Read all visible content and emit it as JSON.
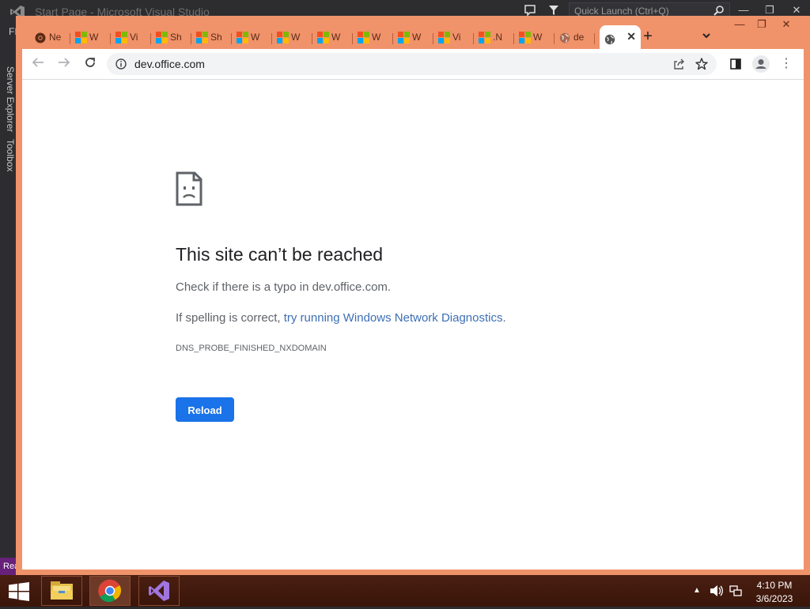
{
  "vs": {
    "title": "Start Page - Microsoft Visual Studio",
    "menu_partial": "FI",
    "quick_launch_placeholder": "Quick Launch (Ctrl+Q)",
    "side_tabs": [
      "Server Explorer",
      "Toolbox"
    ],
    "status_partial": "Rea"
  },
  "browser": {
    "tabs": [
      {
        "label": "Ne",
        "icon": "chrome-icon"
      },
      {
        "label": "W",
        "icon": "microsoft-icon"
      },
      {
        "label": "Vi",
        "icon": "microsoft-icon"
      },
      {
        "label": "Sh",
        "icon": "microsoft-icon"
      },
      {
        "label": "Sh",
        "icon": "microsoft-icon"
      },
      {
        "label": "W",
        "icon": "microsoft-icon"
      },
      {
        "label": "W",
        "icon": "microsoft-icon"
      },
      {
        "label": "W",
        "icon": "microsoft-icon"
      },
      {
        "label": "W",
        "icon": "microsoft-icon"
      },
      {
        "label": "W",
        "icon": "microsoft-icon"
      },
      {
        "label": "Vi",
        "icon": "microsoft-icon"
      },
      {
        "label": ".N",
        "icon": "microsoft-icon"
      },
      {
        "label": "W",
        "icon": "microsoft-icon"
      },
      {
        "label": "de",
        "icon": "globe-icon"
      },
      {
        "label": "",
        "icon": "globe-icon",
        "active": true
      }
    ],
    "url": "dev.office.com"
  },
  "error_page": {
    "title": "This site can’t be reached",
    "line1": "Check if there is a typo in dev.office.com.",
    "line2_prefix": "If spelling is correct, ",
    "line2_link": "try running Windows Network Diagnostics",
    "line2_suffix": ".",
    "code": "DNS_PROBE_FINISHED_NXDOMAIN",
    "reload_label": "Reload"
  },
  "taskbar": {
    "apps": [
      "file-explorer",
      "chrome",
      "visual-studio"
    ],
    "time": "4:10 PM",
    "date": "3/6/2023"
  },
  "colors": {
    "chrome_frame": "#f0926a",
    "link": "#3c6fb5",
    "reload_button": "#1a73e8",
    "vs_status_bar": "#68217a"
  }
}
